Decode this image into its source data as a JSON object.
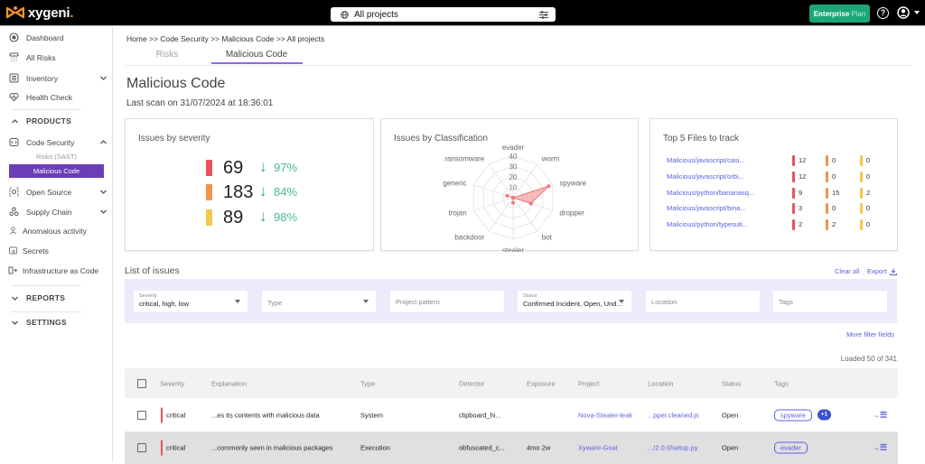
{
  "topbar": {
    "logo_text": "xygeni",
    "logo_dot": ".",
    "project_selector": "All projects",
    "plan_button": {
      "bold": "Enterprise",
      "light": "Plan"
    },
    "help_label": "?"
  },
  "sidebar": {
    "items": [
      {
        "label": "Dashboard",
        "icon": "dashboard-icon"
      },
      {
        "label": "All Risks",
        "icon": "all-risks-icon"
      },
      {
        "label": "Inventory",
        "icon": "inventory-icon",
        "expandable": true
      },
      {
        "label": "Health Check",
        "icon": "health-check-icon"
      }
    ],
    "products": {
      "label": "PRODUCTS",
      "expanded": true,
      "items": [
        {
          "label": "Code Security",
          "icon": "code-security-icon",
          "expanded": true,
          "children": [
            {
              "label": "Risks (SAST)"
            },
            {
              "label": "Malicious Code",
              "active": true
            }
          ]
        },
        {
          "label": "Open Source",
          "icon": "open-source-icon",
          "expandable": true
        },
        {
          "label": "Supply Chain",
          "icon": "supply-chain-icon",
          "expandable": true
        },
        {
          "label": "Anomalous activity",
          "icon": "anomalous-activity-icon"
        },
        {
          "label": "Secrets",
          "icon": "secrets-icon"
        },
        {
          "label": "Infrastructure as Code",
          "icon": "iac-icon"
        }
      ]
    },
    "reports": {
      "label": "REPORTS"
    },
    "settings": {
      "label": "SETTINGS"
    }
  },
  "breadcrumb": "Home >> Code Security >> Malicious Code >> All projects",
  "tabs": [
    {
      "label": "Risks",
      "active": false
    },
    {
      "label": "Malicious Code",
      "active": true
    }
  ],
  "page": {
    "title": "Malicious Code",
    "last_scan": "Last scan on 31/07/2024 at 18:36:01"
  },
  "severity_card": {
    "title": "Issues by severity",
    "rows": [
      {
        "severity": "critical",
        "color": "#e9535a",
        "count": "69",
        "trend": "↓",
        "change": "97%"
      },
      {
        "severity": "high",
        "color": "#f0954a",
        "count": "183",
        "trend": "↓",
        "change": "84%"
      },
      {
        "severity": "low",
        "color": "#f2c94c",
        "count": "89",
        "trend": "↓",
        "change": "98%"
      }
    ]
  },
  "chart_data": {
    "type": "radar",
    "title": "Issues by Classification",
    "categories": [
      "evader",
      "worm",
      "spyware",
      "dropper",
      "bot",
      "stealer",
      "backdoor",
      "trojan",
      "generic",
      "ransomware"
    ],
    "values": [
      0,
      0,
      36,
      18,
      0,
      5,
      0,
      0,
      6,
      0
    ],
    "rlim": [
      0,
      40
    ],
    "ticks": [
      10,
      20,
      30,
      40
    ],
    "grid": true,
    "color": "#f07878"
  },
  "top5_card": {
    "title": "Top 5 Files to track",
    "colors": {
      "critical": "#e9535a",
      "high": "#f0954a",
      "low": "#f2c94c"
    },
    "rows": [
      {
        "file": "Malicious/javascript/casi...",
        "critical": "12",
        "high": "0",
        "low": "0"
      },
      {
        "file": "Malicious/javascript/orbi...",
        "critical": "12",
        "high": "0",
        "low": "0"
      },
      {
        "file": "Malicious/python/bananasq...",
        "critical": "9",
        "high": "15",
        "low": "2"
      },
      {
        "file": "Malicious/javascript/bina...",
        "critical": "3",
        "high": "0",
        "low": "0"
      },
      {
        "file": "Malicious/python/typesuti...",
        "critical": "2",
        "high": "2",
        "low": "0"
      }
    ]
  },
  "issues": {
    "title": "List of issues",
    "clear_all": "Clear all",
    "export": "Export",
    "more_filters": "More filter fields",
    "loaded": "Loaded 50 of 341",
    "filters": [
      {
        "label": "Severity",
        "value": "critical, high, low",
        "kind": "select"
      },
      {
        "placeholder": "Type",
        "kind": "select"
      },
      {
        "placeholder": "Project pattern",
        "kind": "text"
      },
      {
        "label": "Status",
        "value": "Confirmed Incident, Open, Und...",
        "kind": "select"
      },
      {
        "placeholder": "Location",
        "kind": "text"
      },
      {
        "placeholder": "Tags",
        "kind": "text"
      }
    ],
    "columns": [
      "Severity",
      "Explanation",
      "Type",
      "Detector",
      "Exposure",
      "Project",
      "Location",
      "Status",
      "Tags"
    ],
    "rows": [
      {
        "severity": "critical",
        "explanation": "...es its contents with malicious data",
        "type": "System",
        "detector": "clipboard_hi...",
        "exposure": "",
        "project": "Nova-Stealer-leak",
        "location": "...pper.cleaned.js",
        "status": "Open",
        "tags": [
          "spyware"
        ],
        "more_tags": "+1",
        "action": "→☰"
      },
      {
        "severity": "critical",
        "explanation": "...commonly seen in malicious packages",
        "type": "Execution",
        "detector": "obfuscated_c...",
        "exposure": "4mo 2w",
        "project": "Xyware-Goat",
        "location": ".../2.0.0/setup.py",
        "status": "Open",
        "tags": [
          "evader"
        ],
        "action": "→☰"
      }
    ]
  }
}
